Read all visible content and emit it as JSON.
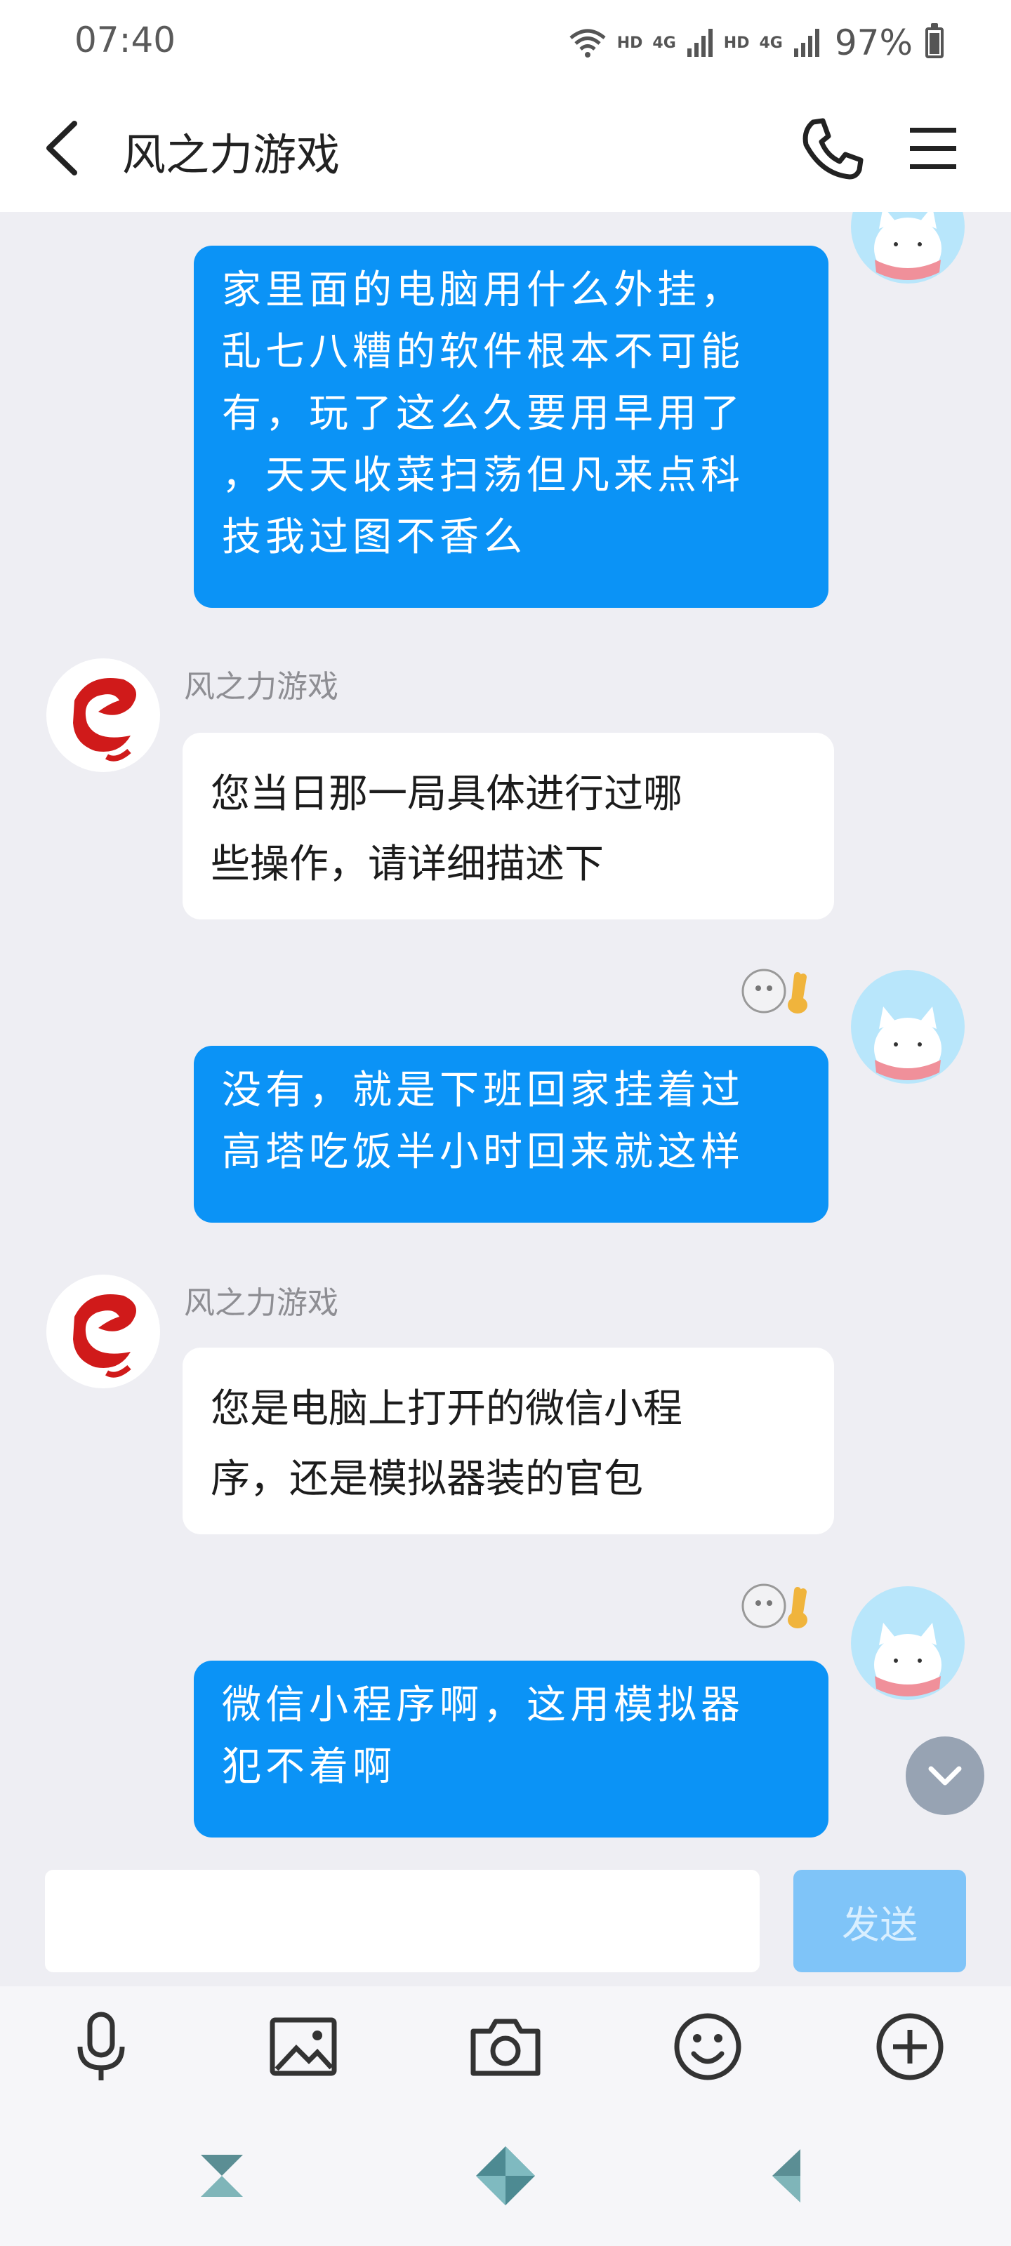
{
  "status_bar": {
    "time": "07:40",
    "hd1": "HD",
    "net1": "4G",
    "hd2": "HD",
    "net2": "4G",
    "battery": "97%",
    "icons": [
      "wifi-icon",
      "signal-icon",
      "signal-icon",
      "battery-icon"
    ]
  },
  "header": {
    "title": "风之力游戏",
    "icons": [
      "back-arrow-icon",
      "phone-icon",
      "menu-icon"
    ]
  },
  "messages": [
    {
      "direction": "outgoing",
      "lines": [
        "家里面的电脑用什么外挂，",
        "乱七八糟的软件根本不可能",
        "有，玩了这么久要用早用了",
        "，天天收菜扫荡但凡来点科",
        "技我过图不香么"
      ]
    },
    {
      "direction": "incoming",
      "sender": "风之力游戏",
      "lines": [
        "您当日那一局具体进行过哪",
        "些操作，请详细描述下"
      ]
    },
    {
      "direction": "outgoing",
      "lines": [
        "没有，就是下班回家挂着过",
        "高塔吃饭半小时回来就这样"
      ]
    },
    {
      "direction": "incoming",
      "sender": "风之力游戏",
      "lines": [
        "您是电脑上打开的微信小程",
        "序，还是模拟器装的官包"
      ]
    },
    {
      "direction": "outgoing",
      "lines": [
        "微信小程序啊，这用模拟器",
        "犯不着啊"
      ]
    }
  ],
  "composer": {
    "input_value": "",
    "input_placeholder": "",
    "send_label": "发送"
  },
  "toolbar": {
    "icons": [
      "microphone-icon",
      "image-icon",
      "camera-icon",
      "emoji-icon",
      "plus-icon"
    ]
  },
  "navbar": {
    "icons": [
      "recents-icon",
      "home-icon",
      "back-icon"
    ]
  },
  "colors": {
    "outgoing_bubble": "#0b93f6",
    "incoming_bubble": "#ffffff",
    "background": "#eeeef3",
    "send_button": "#7fc4f8"
  }
}
